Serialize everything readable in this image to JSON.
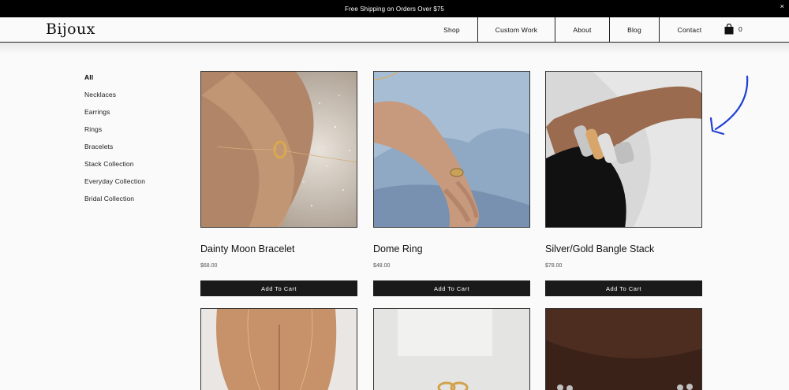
{
  "announcement": {
    "text": "Free Shipping on Orders Over $75",
    "close": "×"
  },
  "header": {
    "logo": "Bijoux",
    "nav": [
      "Shop",
      "Custom Work",
      "About",
      "Blog",
      "Contact"
    ],
    "cart_count": "0",
    "cart_icon": "shopping-bag-icon"
  },
  "sidebar": {
    "items": [
      "All",
      "Necklaces",
      "Earrings",
      "Rings",
      "Bracelets",
      "Stack Collection",
      "Everyday Collection",
      "Bridal Collection"
    ],
    "active": "All"
  },
  "products": [
    {
      "name": "Dainty Moon Bracelet",
      "price": "$68.00",
      "button": "Add To Cart"
    },
    {
      "name": "Dome Ring",
      "price": "$48.00",
      "button": "Add To Cart"
    },
    {
      "name": "Silver/Gold Bangle Stack",
      "price": "$78.00",
      "button": "Add To Cart"
    }
  ],
  "annotation": {
    "arrow_color": "#1f3fd6"
  }
}
